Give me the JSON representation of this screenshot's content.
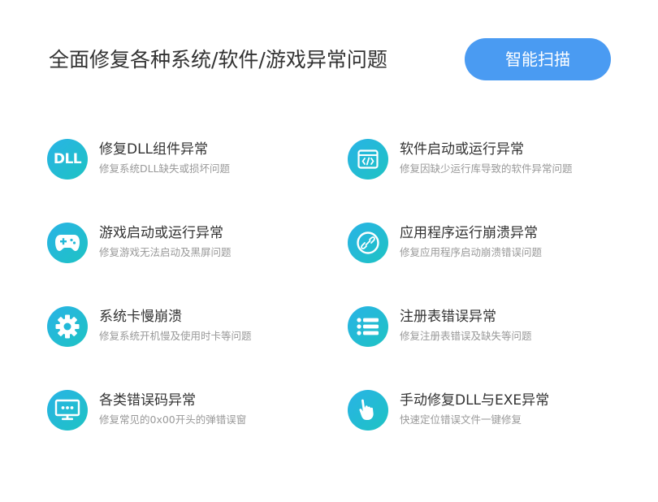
{
  "header": {
    "title": "全面修复各种系统/软件/游戏异常问题",
    "scan_button": "智能扫描"
  },
  "colors": {
    "accent": "#4a9bf2",
    "icon_gradient_start": "#29b3e6",
    "icon_gradient_end": "#1ec3c3",
    "title_text": "#333333",
    "desc_text": "#999999"
  },
  "items": [
    {
      "icon": "dll-icon",
      "icon_text": "DLL",
      "title": "修复DLL组件异常",
      "desc": "修复系统DLL缺失或损坏问题"
    },
    {
      "icon": "code-window-icon",
      "title": "软件启动或运行异常",
      "desc": "修复因缺少运行库导致的软件异常问题"
    },
    {
      "icon": "gamepad-icon",
      "title": "游戏启动或运行异常",
      "desc": "修复游戏无法启动及黑屏问题"
    },
    {
      "icon": "app-link-icon",
      "title": "应用程序运行崩溃异常",
      "desc": "修复应用程序启动崩溃错误问题"
    },
    {
      "icon": "gear-icon",
      "title": "系统卡慢崩溃",
      "desc": "修复系统开机慢及使用时卡等问题"
    },
    {
      "icon": "list-icon",
      "title": "注册表错误异常",
      "desc": "修复注册表错误及缺失等问题"
    },
    {
      "icon": "monitor-icon",
      "title": "各类错误码异常",
      "desc": "修复常见的0x00开头的弹错误窗"
    },
    {
      "icon": "hand-pointer-icon",
      "title": "手动修复DLL与EXE异常",
      "desc": "快速定位错误文件一键修复"
    }
  ]
}
